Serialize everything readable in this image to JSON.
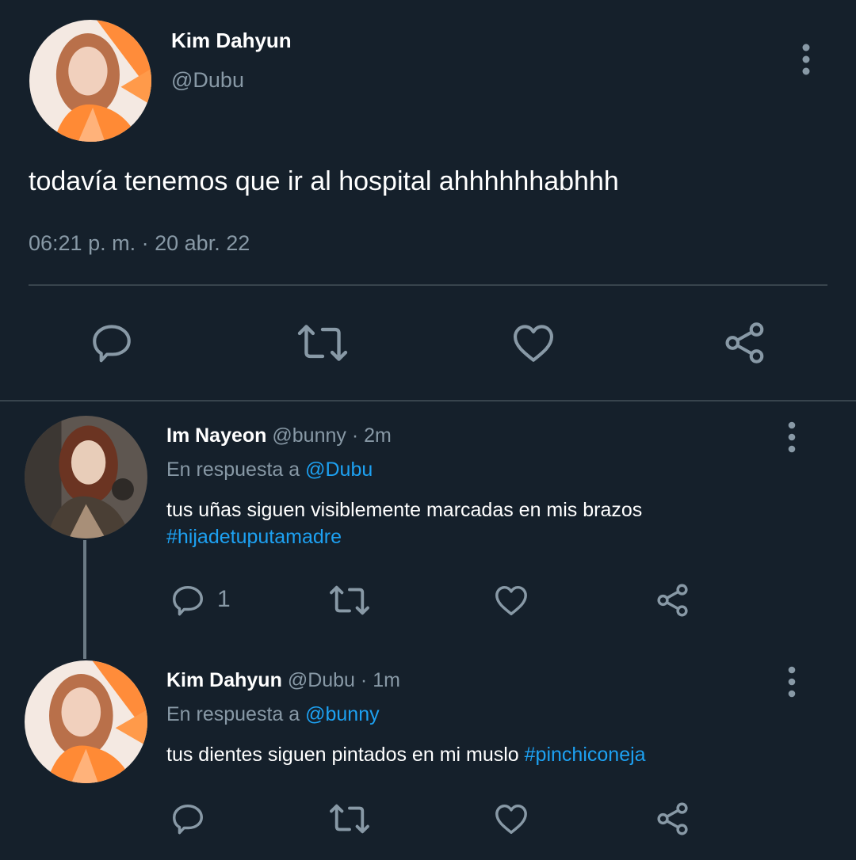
{
  "main_tweet": {
    "name": "Kim Dahyun",
    "handle": "@Dubu",
    "text": "todavía tenemos que ir al hospital ahhhhhhabhhh",
    "time": "06:21 p. m.",
    "separator": "·",
    "date": "20 abr. 22",
    "actions": [
      "reply-icon",
      "retweet-icon",
      "like-icon",
      "share-icon"
    ]
  },
  "replies": [
    {
      "name": "Im Nayeon",
      "handle": "@bunny",
      "separator": "·",
      "time": "2m",
      "reply_to_label": "En respuesta a",
      "reply_to_handle": "@Dubu",
      "text": "tus uñas siguen visiblemente marcadas en mis brazos",
      "hashtag": "#hijadetuputamadre",
      "reply_count": "1"
    },
    {
      "name": "Kim Dahyun",
      "handle": "@Dubu",
      "separator": "·",
      "time": "1m",
      "reply_to_label": "En respuesta a",
      "reply_to_handle": "@bunny",
      "text": "tus dientes siguen pintados en mi muslo",
      "hashtag": "#pinchiconeja"
    }
  ],
  "colors": {
    "background": "#15202b",
    "divider": "#38444d",
    "secondary_text": "#8899a6",
    "link": "#1da1f2",
    "icon": "#8899a6"
  }
}
